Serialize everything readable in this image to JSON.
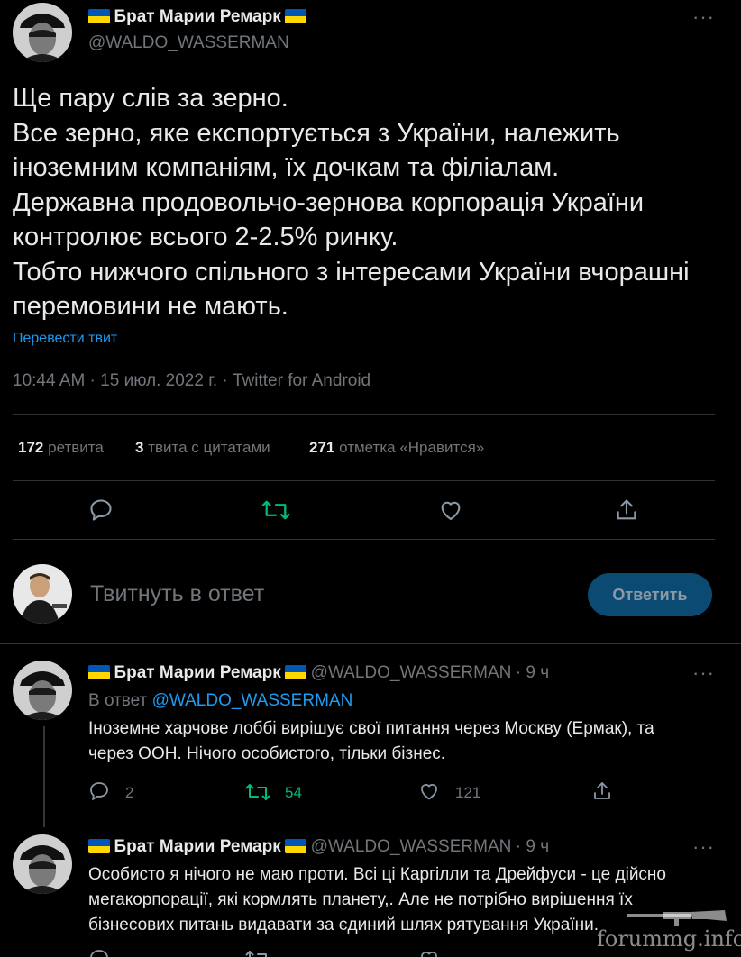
{
  "tweet": {
    "author_name": "Брат Марии Ремарк",
    "author_handle": "@WALDO_WASSERMAN",
    "text": "Ще пару слів за зерно.\nВсе зерно, яке експортується з України, належить іноземним компаніям, їх дочкам та філіалам.\nДержавна продовольчо-зернова корпорація України контролює всього 2-2.5% ринку.\nТобто нижчого спільного з інтересами України вчорашні перемовини не мають.",
    "translate_label": "Перевести твит",
    "meta": "10:44 AM · 15 июл. 2022 г. · Twitter for Android",
    "stats": {
      "retweets_count": "172",
      "retweets_label": "ретвита",
      "quotes_count": "3",
      "quotes_label": "твита с цитатами",
      "likes_count": "271",
      "likes_label": "отметка «Нравится»"
    }
  },
  "compose": {
    "placeholder": "Твитнуть в ответ",
    "button_label": "Ответить"
  },
  "replies": [
    {
      "author_name": "Брат Марии Ремарк",
      "author_handle": "@WALDO_WASSERMAN",
      "time": "· 9 ч",
      "in_reply_prefix": "В ответ",
      "in_reply_handle": "@WALDO_WASSERMAN",
      "text": "Іноземне харчове лоббі вирішує свої питання через Москву (Ермак), та\nчерез ООН. Нічого особистого, тільки бізнес.",
      "replies_count": "2",
      "retweets_count": "54",
      "likes_count": "121"
    },
    {
      "author_name": "Брат Марии Ремарк",
      "author_handle": "@WALDO_WASSERMAN",
      "time": "· 9 ч",
      "text": "Особисто я нічого не маю проти. Всі ці Каргілли та Дрейфуси - це дійсно\nмегакорпорації, які кормлять планету,. Але не потрібно вирішення їх\nбізнесових питань видавати за єдиний шлях рятування України."
    }
  ],
  "watermark": "forummg.info",
  "colors": {
    "background": "#000000",
    "text": "#e7e9ea",
    "muted": "#71767b",
    "link": "#1d9bf0",
    "retweet_active": "#00ba7c",
    "divider": "#2f3336",
    "reply_button_bg": "#0b4a72"
  },
  "icons": [
    "reply-icon",
    "retweet-icon",
    "like-icon",
    "share-icon",
    "more-icon",
    "ukraine-flag-icon"
  ]
}
